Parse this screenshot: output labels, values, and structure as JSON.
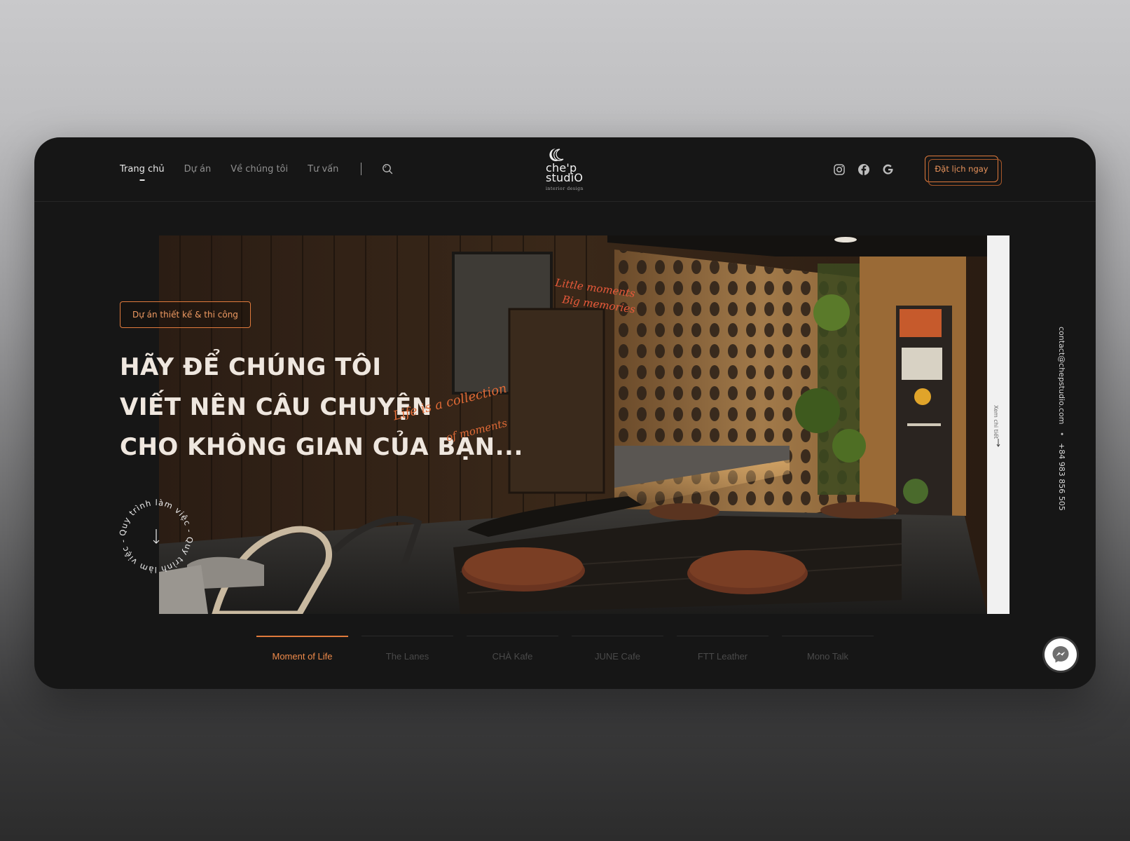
{
  "nav": {
    "items": [
      {
        "label": "Trang chủ",
        "active": true
      },
      {
        "label": "Dự án",
        "active": false
      },
      {
        "label": "Về chúng tôi",
        "active": false
      },
      {
        "label": "Tư vấn",
        "active": false
      }
    ]
  },
  "logo": {
    "line1": "che'p",
    "line2": "studiO",
    "sub": "interior design"
  },
  "socials": {
    "icons": [
      "instagram-icon",
      "facebook-icon",
      "google-icon"
    ]
  },
  "cta": {
    "label": "Đặt lịch ngay"
  },
  "hero": {
    "tag": "Dự án thiết kế & thi công",
    "headline": [
      "HÃY ĐỂ CHÚNG TÔI",
      "VIẾT NÊN CÂU CHUYỆN",
      "CHO KHÔNG GIAN CỦA BẠN..."
    ],
    "script_line1": "Life is a collection",
    "script_line2": "of moments",
    "badge_text": "Quy trình làm việc  -  Quy trình làm việc  -  ",
    "side_link": "Xem chi tiết",
    "neon_line1": "Little moments",
    "neon_line2": "Big memories"
  },
  "contact": {
    "email": "contact@chepstudio.com",
    "separator": "•",
    "phone": "+84 983 856 505"
  },
  "tabs": [
    {
      "label": "Moment of Life",
      "active": true
    },
    {
      "label": "The Lanes",
      "active": false
    },
    {
      "label": "CHÀ Kafe",
      "active": false
    },
    {
      "label": "JUNE Cafe",
      "active": false
    },
    {
      "label": "FTT Leather",
      "active": false
    },
    {
      "label": "Mono Talk",
      "active": false
    }
  ],
  "colors": {
    "accent": "#e07a3c",
    "background": "#161616"
  }
}
